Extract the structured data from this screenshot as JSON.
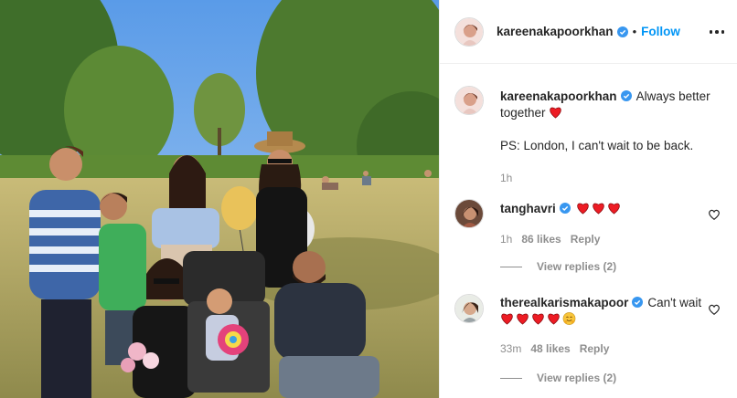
{
  "post": {
    "username": "kareenakapoorkhan",
    "follow_separator": "•",
    "follow_label": "Follow",
    "more_icon": "more-options-icon"
  },
  "caption": {
    "username": "kareenakapoorkhan",
    "text_1": "Always better together",
    "text_2": "PS: London, I can't wait to be back.",
    "time": "1h"
  },
  "comments": [
    {
      "username": "tanghavri",
      "text": "",
      "time": "1h",
      "likes": "86 likes",
      "reply": "Reply",
      "view_replies": "View replies (2)"
    },
    {
      "username": "therealkarismakapoor",
      "text": "Can't wait",
      "time": "33m",
      "likes": "48 likes",
      "reply": "Reply",
      "view_replies": "View replies (2)"
    }
  ],
  "colors": {
    "accent": "#0095f6",
    "verified": "#3897f0",
    "heart": "#ed1c24",
    "muted": "#8e8e8e"
  }
}
